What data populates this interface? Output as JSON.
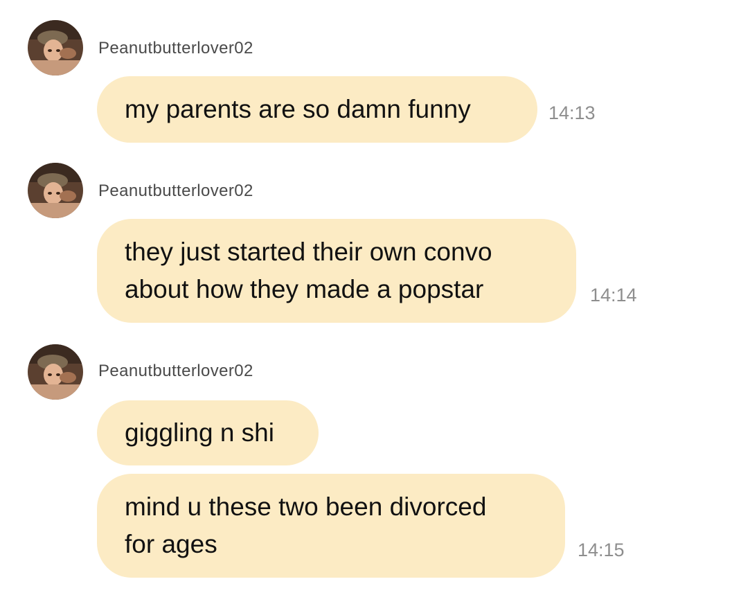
{
  "chat": {
    "groups": [
      {
        "sender": "Peanutbutterlover02",
        "avatar_icon": "profile-photo-avatar",
        "messages": [
          {
            "lines": [
              "my parents are so damn funny"
            ],
            "time": "14:13"
          }
        ]
      },
      {
        "sender": "Peanutbutterlover02",
        "avatar_icon": "profile-photo-avatar",
        "messages": [
          {
            "lines": [
              "they just started their own convo",
              "about how they made a popstar"
            ],
            "time": "14:14"
          }
        ]
      },
      {
        "sender": "Peanutbutterlover02",
        "avatar_icon": "profile-photo-avatar",
        "messages": [
          {
            "lines": [
              "giggling n shi"
            ],
            "time": ""
          },
          {
            "lines": [
              "mind u these two been divorced",
              "for ages"
            ],
            "time": "14:15"
          }
        ]
      }
    ]
  },
  "colors": {
    "bubble_background": "#fcebc4",
    "message_text": "#111111",
    "sender_text": "#4a4a4a",
    "timestamp_text": "#8e8e8e",
    "page_background": "#ffffff"
  }
}
